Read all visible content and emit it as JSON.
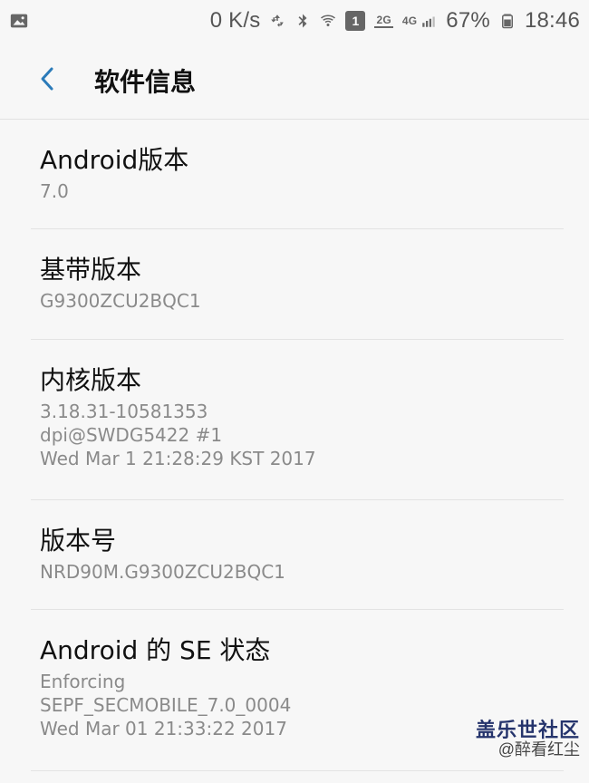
{
  "statusbar": {
    "left_icon": "image-icon",
    "net_speed": "0 K/s",
    "sim_badge": "1",
    "two_g": "2G",
    "four_g": "4G",
    "battery_percent": "67%",
    "time": "18:46"
  },
  "header": {
    "title": "软件信息",
    "back_icon": "chevron-left-icon"
  },
  "items": [
    {
      "title": "Android版本",
      "subtitle": "7.0"
    },
    {
      "title": "基带版本",
      "subtitle": "G9300ZCU2BQC1"
    },
    {
      "title": "内核版本",
      "subtitle": "3.18.31-10581353\ndpi@SWDG5422 #1\nWed Mar 1 21:28:29 KST 2017"
    },
    {
      "title": "版本号",
      "subtitle": "NRD90M.G9300ZCU2BQC1"
    },
    {
      "title": "Android 的 SE 状态",
      "subtitle": "Enforcing\nSEPF_SECMOBILE_7.0_0004\nWed Mar 01 21:33:22 2017"
    }
  ],
  "watermark": {
    "top": "盖乐世社区",
    "bottom": "@醉看红尘"
  },
  "colors": {
    "background": "#f7f7f7",
    "accent": "#2b7bb9",
    "divider": "#e3e3e3",
    "subtitle": "#8a8a8a"
  }
}
